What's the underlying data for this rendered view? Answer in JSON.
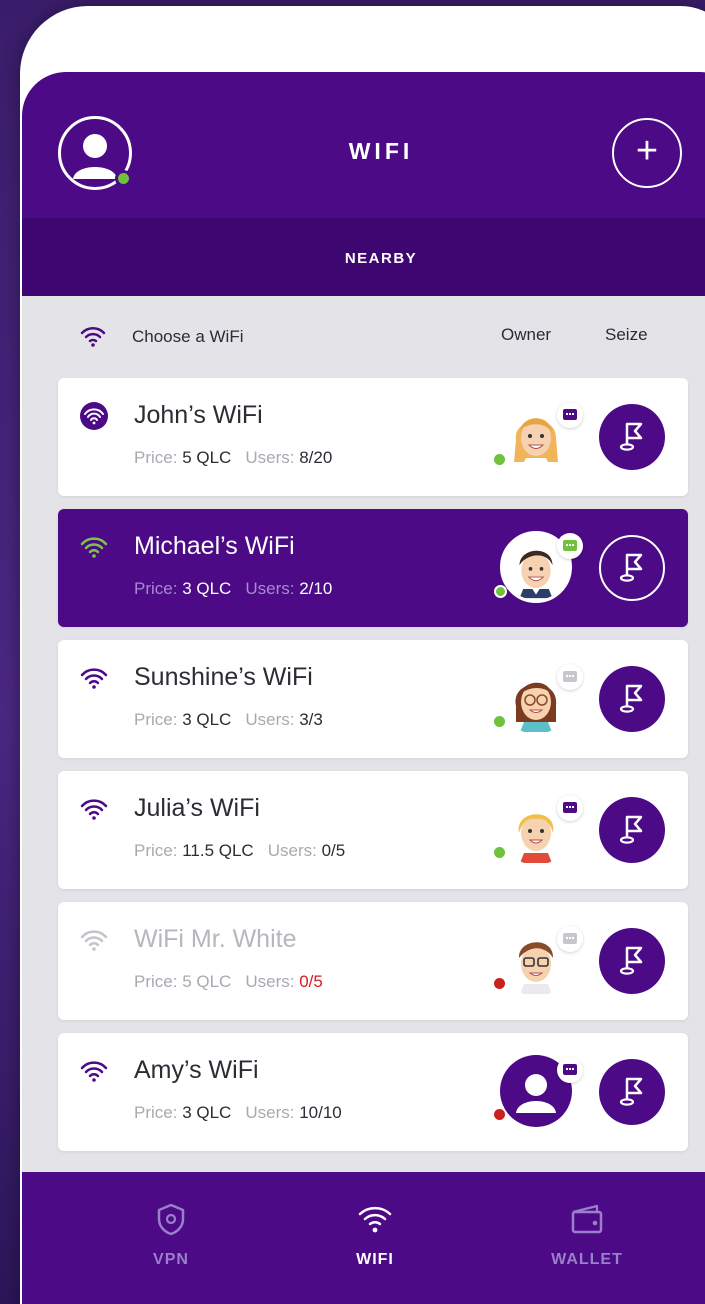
{
  "header": {
    "title": "WIFI",
    "add_label": "+"
  },
  "tabs": {
    "nearby": "NEARBY"
  },
  "list_header": {
    "choose": "Choose a WiFi",
    "owner": "Owner",
    "seize": "Seize"
  },
  "labels": {
    "price": "Price:",
    "users": "Users:"
  },
  "networks": [
    {
      "name": "John’s WiFi",
      "price": "5 QLC",
      "users": "8/20",
      "owner_status": "online"
    },
    {
      "name": "Michael’s WiFi",
      "price": "3 QLC",
      "users": "2/10",
      "owner_status": "online"
    },
    {
      "name": "Sunshine’s WiFi",
      "price": "3 QLC",
      "users": "3/3",
      "owner_status": "online"
    },
    {
      "name": "Julia’s WiFi",
      "price": "11.5 QLC",
      "users": "0/5",
      "owner_status": "online"
    },
    {
      "name": "WiFi Mr. White",
      "price": "5 QLC",
      "users": "0/5",
      "owner_status": "offline"
    },
    {
      "name": "Amy’s WiFi",
      "price": "3 QLC",
      "users": "10/10",
      "owner_status": "offline"
    }
  ],
  "bottom_nav": {
    "vpn": "VPN",
    "wifi": "WIFI",
    "wallet": "WALLET"
  },
  "colors": {
    "brand_purple": "#4c0a86",
    "online": "#6fc13e",
    "offline": "#c9211d"
  }
}
